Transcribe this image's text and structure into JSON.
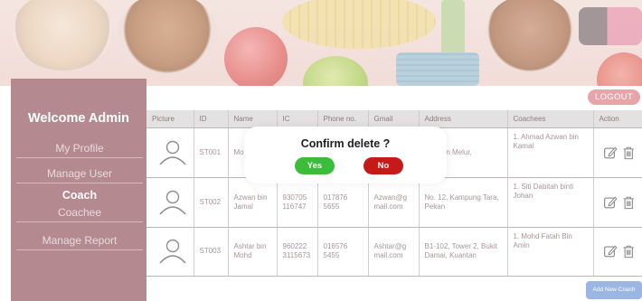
{
  "header": {
    "logout_label": "LOGOUT"
  },
  "sidebar": {
    "welcome": "Welcome Admin",
    "items": [
      {
        "label": "My Profile"
      },
      {
        "label": "Manage User"
      },
      {
        "label": "Coach"
      },
      {
        "label": "Coachee"
      },
      {
        "label": "Manage Report"
      }
    ]
  },
  "table": {
    "columns": [
      "Picture",
      "ID",
      "Name",
      "IC",
      "Phone no.",
      "Gmail",
      "Address",
      "Coachees",
      "Action"
    ],
    "rows": [
      {
        "id": "ST001",
        "name": "Mo Cr",
        "ic": "",
        "phone": "",
        "gmail": "",
        "address": ", Taman Melur,",
        "coachees": "1. Ahmad Azwan bin Kamal"
      },
      {
        "id": "ST002",
        "name": "Azwan bin Jamal",
        "ic": "930705 116747",
        "phone": "017876 5655",
        "gmail": "Azwan@g mail.com",
        "address": "No. 12, Kampung Tara, Pekan",
        "coachees": "1. Siti Dabitah binti Johan"
      },
      {
        "id": "ST003",
        "name": "Ashtar bin Mohd",
        "ic": "960222 3115673",
        "phone": "016576 5455",
        "gmail": "Ashtar@g mail.com",
        "address": "B1-102, Tower 2, Bukit Damai, Kuantan",
        "coachees": "1. Mohd Fatah Bin Amin"
      }
    ]
  },
  "add_coach_label": "Add New Coach",
  "dialog": {
    "title": "Confirm delete ?",
    "yes_label": "Yes",
    "no_label": "No"
  },
  "colors": {
    "sidebar": "#b48a90",
    "yes": "#3bbd3b",
    "no": "#c51a18",
    "logout": "#e8a4a8",
    "add_button": "#9cb6e4"
  }
}
